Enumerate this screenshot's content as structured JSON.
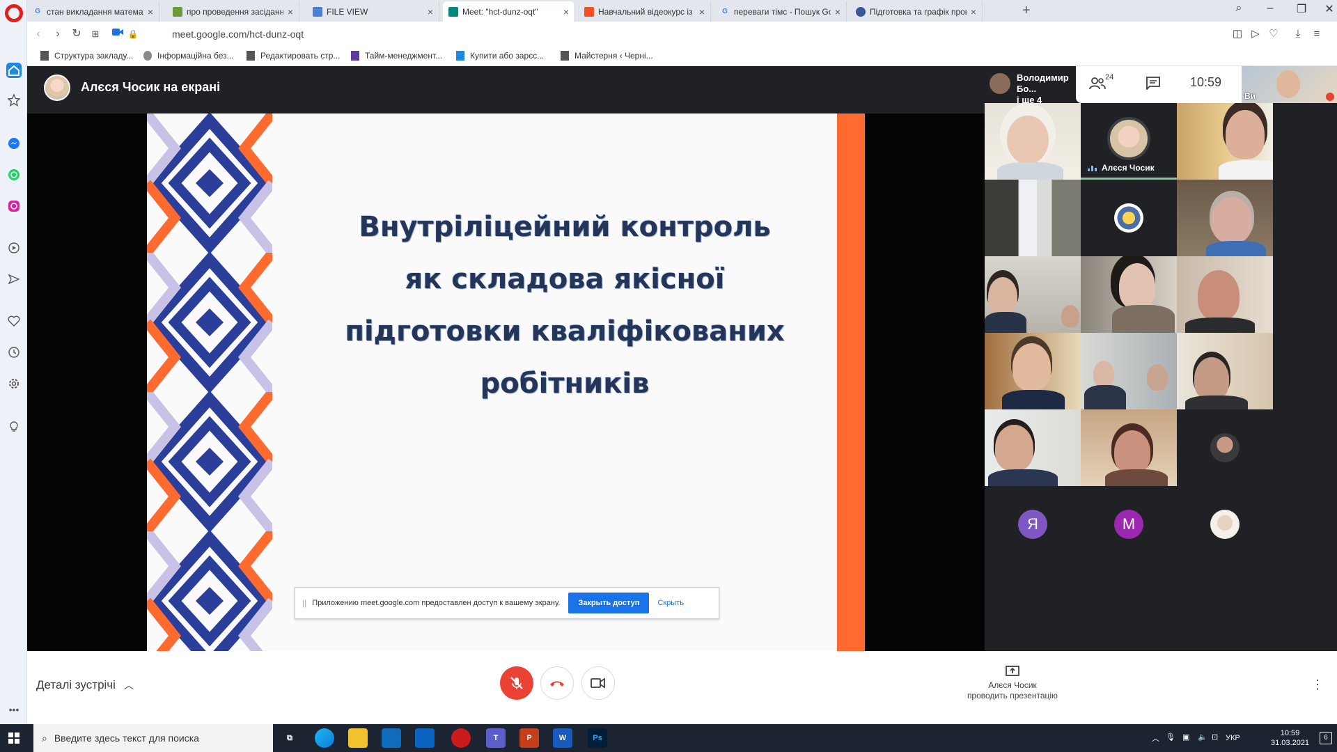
{
  "browser": {
    "tabs": [
      {
        "title": "стан викладання математ",
        "favicon": "G",
        "favicon_color": "#4285f4"
      },
      {
        "title": "про проведення засідання",
        "favicon": "▪",
        "favicon_color": "#6a9a3a"
      },
      {
        "title": "FILE VIEW",
        "favicon": "▪",
        "favicon_color": "#4a7fd4"
      },
      {
        "title": "Meet: \"hct-dunz-oqt\"",
        "favicon": "▪",
        "favicon_color": "#00897b"
      },
      {
        "title": "Навчальний відеокурс із",
        "favicon": "▪",
        "favicon_color": "#f25022"
      },
      {
        "title": "переваги тімс - Пошук Go",
        "favicon": "G",
        "favicon_color": "#4285f4"
      },
      {
        "title": "Підготовка та графік пров",
        "favicon": "▪",
        "favicon_color": "#3b5998"
      }
    ],
    "new_tab_label": "+",
    "url": "meet.google.com/hct-dunz-oqt",
    "bookmarks": [
      "Структура закладу...",
      "Інформаційна без...",
      "Редактировать стр...",
      "Тайм-менеджмент...",
      "Купити або зарєс...",
      "Майстерня ‹ Черні..."
    ]
  },
  "meet": {
    "presenter_title": "Алєся Чосик на екрані",
    "slide": {
      "lines": [
        "Внутріліцейний контроль",
        "як складова якісної",
        "підготовки кваліфікованих",
        "робітників"
      ]
    },
    "share_notice": {
      "grip": "||",
      "message": "Приложению meet.google.com предоставлен доступ к вашему экрану.",
      "stop_button": "Закрыть доступ",
      "hide_link": "Скрыть"
    },
    "pinned": {
      "name_line1": "Володимир Бо...",
      "name_line2": "і ще 4"
    },
    "people_count": "24",
    "clock": "10:59",
    "self_label": "Ви",
    "speaker_name": "Алєся Чосик",
    "avatars": {
      "letter1": "Я",
      "letter2": "М",
      "letter1_color": "#7e57c2",
      "letter2_color": "#9c27b0"
    },
    "meeting_details": "Деталі зустрічі",
    "presenting_line1": "Алєся Чосик",
    "presenting_line2": "проводить презентацію"
  },
  "taskbar": {
    "search_placeholder": "Введите здесь текст для поиска",
    "lang": "УКР",
    "time": "10:59",
    "date": "31.03.2021",
    "notifications": "6"
  },
  "colors": {
    "accent_blue": "#1a73e8",
    "hangup_red": "#ea4335",
    "slide_orange": "#ff6a2e",
    "slide_navy": "#2b3f9a"
  }
}
